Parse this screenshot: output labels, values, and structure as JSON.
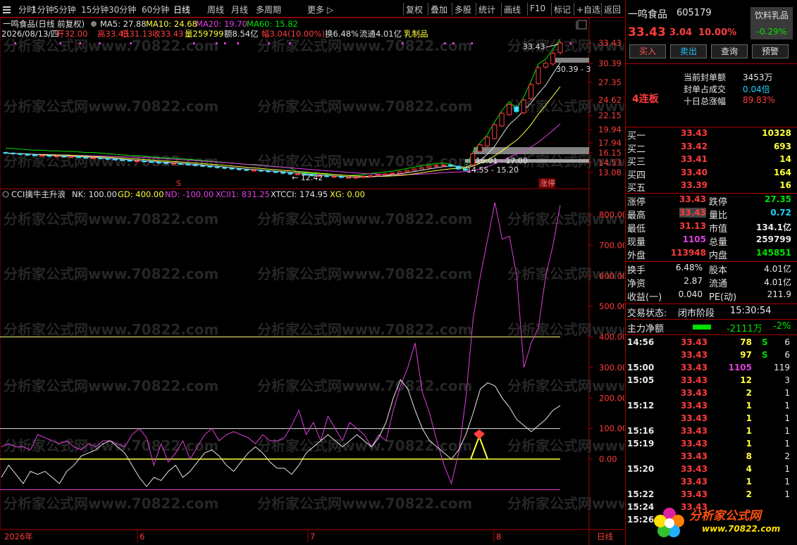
{
  "toolbar": {
    "items": [
      "分时",
      "1分钟",
      "5分钟",
      "15分钟",
      "30分钟",
      "60分钟",
      "日线",
      "周线",
      "月线",
      "多周期",
      "更多 ▷"
    ],
    "active": "日线",
    "right_items": [
      "复权",
      "叠加",
      "多股",
      "统计",
      "画线",
      "F10",
      "标记",
      "+自选",
      "返回"
    ]
  },
  "chart_header": {
    "title": "一鸣食品(日线 前复权)",
    "ma5": "MA5: 27.88",
    "ma10": "MA10: 24.68",
    "ma20": "MA20: 19.70",
    "ma60": "MA60: 15.82"
  },
  "info_line": {
    "date": "2026/08/13/四",
    "open": "开32.00",
    "high": "高33.43",
    "low": "低31.13",
    "close": "收33.43",
    "vol": "量259799",
    "amt": "额8.54亿",
    "chg": "幅3.04(10.00%)",
    "turn": "换6.48%",
    "float": "流通4.01亿",
    "sector": "乳制品"
  },
  "price_axis": [
    "33.43",
    "30.39",
    "27.35",
    "24.62",
    "22.15",
    "19.94",
    "17.94",
    "16.15",
    "14.53",
    "13.08"
  ],
  "annotations": {
    "high": "33.43",
    "band1": "30.39 - 3",
    "band2": "16.01 - 17.00",
    "band3": "14.55 - 15.20",
    "low": "12.42",
    "lianban": "4连板",
    "zhangting": "涨停",
    "s_marker": "S"
  },
  "indicator": {
    "name": "CCI擒牛主升浪",
    "nk": "NK: 100.00",
    "gd": "GD: 400.00",
    "nd": "ND: -100.00",
    "xcii": "XCII1: 831.25",
    "xtcci": "XTCCI: 174.95",
    "xg": "XG: 0.00"
  },
  "ind_axis": [
    "800.00",
    "700.00",
    "600.00",
    "500.00",
    "400.00",
    "300.00",
    "200.00",
    "100.00",
    "0.00"
  ],
  "x_axis": {
    "year": "2026年",
    "m6": "6",
    "m7": "7",
    "m8": "8",
    "period": "日线"
  },
  "chart_data": {
    "type": "line",
    "title": "一鸣食品(日线 前复权)",
    "series": [
      {
        "name": "XCII1",
        "color": "#e040e0",
        "values": [
          40,
          50,
          40,
          40,
          30,
          80,
          70,
          60,
          50,
          60,
          40,
          30,
          50,
          40,
          60,
          60,
          50,
          40,
          80,
          100,
          70,
          -20,
          50,
          -10,
          20,
          60,
          0,
          40,
          80,
          100,
          60,
          80,
          90,
          80,
          70,
          50,
          80,
          60,
          60,
          70,
          110,
          160,
          80,
          120,
          60,
          140,
          100,
          60,
          120,
          100,
          80,
          40,
          80,
          60,
          160,
          240,
          300,
          380,
          220,
          150,
          60,
          -20,
          -80,
          20,
          200,
          460,
          600,
          720,
          840,
          720,
          730,
          600,
          300,
          380,
          430,
          600,
          700,
          831.25
        ]
      },
      {
        "name": "XTCCI",
        "color": "#e8e8e8",
        "values": [
          -60,
          -20,
          -50,
          -80,
          -40,
          -50,
          -40,
          -60,
          -80,
          -40,
          -20,
          10,
          20,
          30,
          50,
          60,
          40,
          20,
          -20,
          -60,
          -90,
          -60,
          -70,
          -40,
          -20,
          -60,
          -40,
          -10,
          20,
          30,
          10,
          -20,
          -40,
          -10,
          20,
          40,
          20,
          -10,
          -30,
          -30,
          -50,
          -20,
          20,
          40,
          60,
          80,
          60,
          40,
          60,
          80,
          60,
          40,
          70,
          120,
          200,
          260,
          230,
          160,
          100,
          60,
          40,
          20,
          0,
          30,
          80,
          150,
          230,
          250,
          240,
          200,
          170,
          130,
          110,
          90,
          110,
          130,
          160,
          174.95
        ]
      },
      {
        "name": "XG",
        "color": "#ffff40",
        "values": [
          0,
          0,
          0,
          0,
          0,
          0,
          0,
          0,
          0,
          0,
          0,
          0,
          0,
          0,
          0,
          0,
          0,
          0,
          0,
          0,
          0,
          0,
          0,
          0,
          0,
          0,
          0,
          0,
          0,
          0,
          0,
          0,
          0,
          0,
          0,
          0,
          0,
          0,
          0,
          0,
          0,
          0,
          0,
          0,
          0,
          0,
          0,
          0,
          0,
          0,
          0,
          0,
          0,
          0,
          0,
          0,
          0,
          0,
          0,
          0,
          0,
          0,
          0,
          0,
          0,
          0,
          0,
          0,
          0,
          0,
          0,
          0,
          0,
          0,
          0,
          0,
          0,
          0
        ]
      }
    ],
    "ylim": [
      -200,
      850
    ],
    "reference_lines": [
      -100,
      0,
      100,
      400
    ]
  },
  "candles": {
    "open": [
      16.2,
      16.1,
      16.0,
      15.9,
      15.8,
      15.7,
      15.7,
      15.6,
      15.6,
      15.5,
      15.5,
      15.4,
      15.3,
      15.3,
      15.2,
      15.1,
      15.0,
      14.9,
      14.8,
      14.8,
      14.7,
      14.6,
      14.5,
      14.4,
      14.4,
      14.3,
      14.2,
      14.1,
      14.0,
      13.9,
      13.8,
      13.7,
      13.6,
      13.5,
      13.4,
      13.4,
      13.3,
      13.2,
      13.1,
      13.0,
      12.9,
      12.9,
      12.8,
      12.7,
      12.7,
      12.6,
      12.6,
      12.5,
      12.5,
      12.5,
      12.6,
      12.7,
      12.8,
      12.9,
      13.0,
      13.2,
      13.4,
      13.6,
      13.8,
      14.0,
      14.1,
      14.2,
      14.0,
      13.6,
      14.2,
      16.4,
      17.4,
      18.6,
      20.5,
      22.3,
      23.5,
      22.6,
      24.8,
      27.2,
      29.8,
      30.3,
      32.0
    ],
    "close": [
      16.1,
      16.0,
      15.9,
      15.8,
      15.7,
      15.7,
      15.6,
      15.6,
      15.5,
      15.5,
      15.4,
      15.3,
      15.3,
      15.2,
      15.1,
      15.0,
      14.9,
      14.8,
      14.8,
      14.7,
      14.6,
      14.5,
      14.4,
      14.4,
      14.3,
      14.2,
      14.1,
      14.0,
      13.9,
      13.8,
      13.7,
      13.6,
      13.5,
      13.4,
      13.4,
      13.3,
      13.2,
      13.1,
      13.0,
      12.9,
      12.9,
      12.8,
      12.7,
      12.7,
      12.6,
      12.6,
      12.5,
      12.5,
      12.5,
      12.6,
      12.7,
      12.8,
      12.9,
      13.0,
      13.2,
      13.4,
      13.6,
      13.8,
      14.0,
      14.1,
      14.2,
      14.0,
      13.6,
      13.4,
      16.0,
      17.6,
      18.8,
      20.7,
      22.5,
      23.9,
      22.8,
      24.6,
      27.0,
      29.7,
      30.4,
      31.9,
      33.43
    ]
  },
  "quote": {
    "name": "一鸣食品",
    "code": "605179",
    "sector": "饮料乳品",
    "sector_chg": "-0.29%",
    "price": "33.43",
    "chg": "3.04",
    "pct": "10.00%",
    "buttons": [
      "买入",
      "卖出",
      "查询",
      "预警"
    ],
    "seal_labels": [
      "当前封单额",
      "封单占成交",
      "十日总涨幅"
    ],
    "seal_values": [
      "3453万",
      "0.04倍",
      "89.83%"
    ]
  },
  "orderbook": [
    [
      "买一",
      "33.43",
      "10328"
    ],
    [
      "买二",
      "33.42",
      "693"
    ],
    [
      "买三",
      "33.41",
      "14"
    ],
    [
      "买四",
      "33.40",
      "164"
    ],
    [
      "买五",
      "33.39",
      "16"
    ]
  ],
  "stats": [
    [
      "涨停",
      "33.43",
      "跌停",
      "27.35"
    ],
    [
      "最高",
      "33.43",
      "量比",
      "0.72"
    ],
    [
      "最低",
      "31.13",
      "市值",
      "134.1亿"
    ],
    [
      "现量",
      "1105",
      "总量",
      "259799"
    ],
    [
      "外盘",
      "113948",
      "内盘",
      "145851"
    ]
  ],
  "stats2": [
    [
      "换手",
      "6.48%",
      "股本",
      "4.01亿"
    ],
    [
      "净资",
      "2.87",
      "流通",
      "4.01亿"
    ],
    [
      "收益(一)",
      "0.040",
      "PE(动)",
      "211.9"
    ]
  ],
  "status": {
    "label": "交易状态:",
    "value": "闭市阶段",
    "time": "15:30:54"
  },
  "mainforce": {
    "label": "主力净额",
    "value": "-2111万",
    "pct": "-2%"
  },
  "ticks": [
    [
      "14:56",
      "33.43",
      "78",
      "S",
      "6"
    ],
    [
      "",
      "33.43",
      "97",
      "S",
      "6"
    ],
    [
      "15:00",
      "33.43",
      "1105",
      "",
      "119"
    ],
    [
      "15:05",
      "33.43",
      "12",
      "",
      "3"
    ],
    [
      "",
      "33.43",
      "2",
      "",
      "1"
    ],
    [
      "15:12",
      "33.43",
      "1",
      "",
      "1"
    ],
    [
      "",
      "33.43",
      "1",
      "",
      "1"
    ],
    [
      "15:16",
      "33.43",
      "1",
      "",
      "1"
    ],
    [
      "15:19",
      "33.43",
      "1",
      "",
      "1"
    ],
    [
      "",
      "33.43",
      "8",
      "",
      "2"
    ],
    [
      "15:20",
      "33.43",
      "4",
      "",
      "1"
    ],
    [
      "",
      "33.43",
      "1",
      "",
      "1"
    ],
    [
      "15:22",
      "33.43",
      "2",
      "",
      "1"
    ],
    [
      "15:24",
      "33.43",
      "",
      "",
      ""
    ],
    [
      "15:26",
      "",
      "",
      "",
      ""
    ]
  ],
  "watermark": "分析家公式网www.70822.com",
  "logo": {
    "text": "分析家公式网",
    "url": "www.70822.com"
  }
}
